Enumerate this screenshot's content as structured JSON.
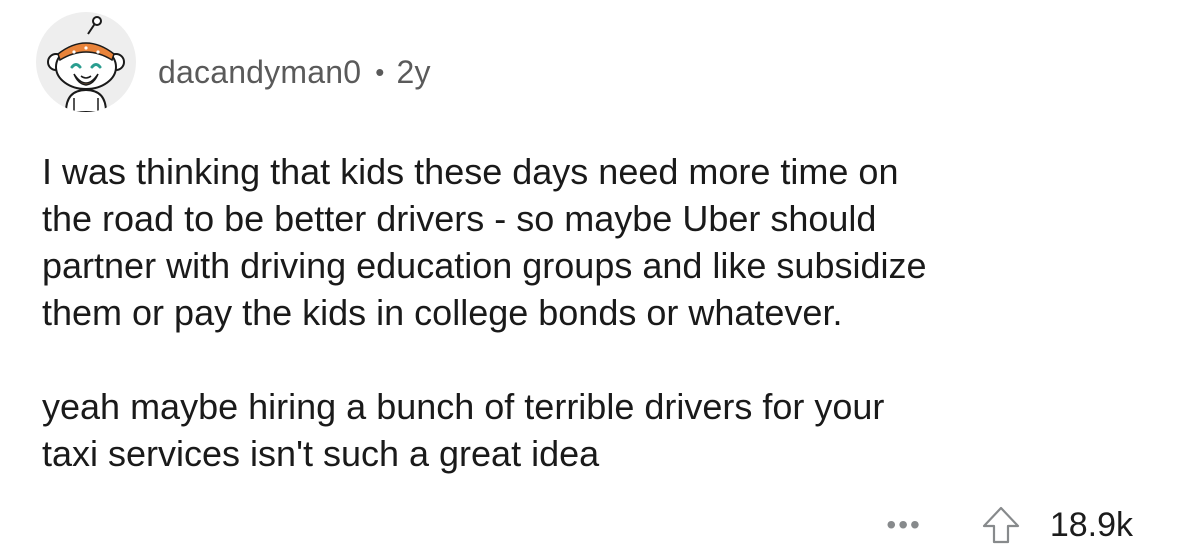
{
  "comment": {
    "username": "dacandyman0",
    "separator": "•",
    "age": "2y",
    "paragraphs": [
      "I was thinking that kids these days need more time on\nthe road to be better drivers - so maybe Uber should\npartner with driving education groups and like subsidize\nthem or pay the kids in college bonds or whatever.",
      "yeah maybe hiring a bunch of terrible drivers for your\ntaxi services isn't such a great idea"
    ]
  },
  "actions": {
    "more": "•••",
    "score": "18.9k",
    "upvote_icon": "arrow-up-icon",
    "more_icon": "more-options-icon"
  },
  "colors": {
    "meta_text": "#5a5a5a",
    "body_text": "#1a1a1a",
    "icon_gray": "#878a8c",
    "avatar_bg": "#eeeeee",
    "bandana": "#e8833a"
  }
}
